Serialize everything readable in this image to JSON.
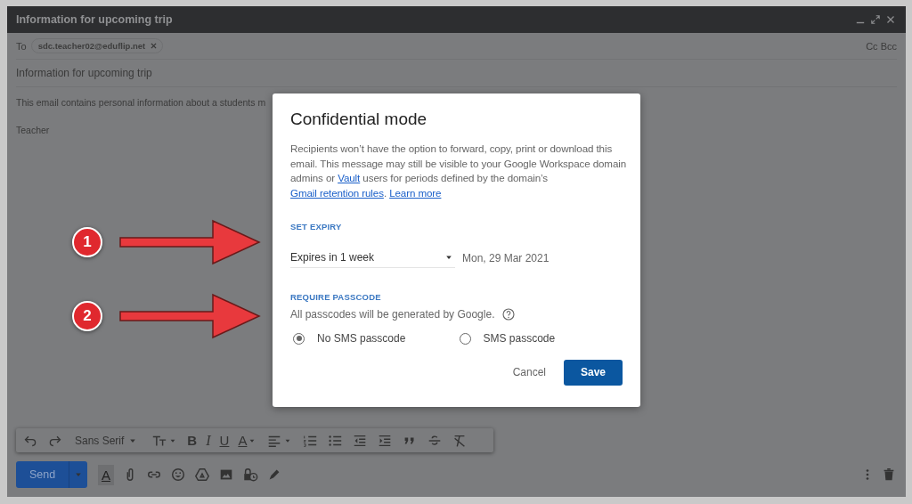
{
  "window": {
    "title": "Information for upcoming trip"
  },
  "compose": {
    "to_label": "To",
    "recipients": [
      {
        "address": "sdc.teacher02@eduflip.net"
      }
    ],
    "cc_bcc": "Cc Bcc",
    "subject": "Information for upcoming trip",
    "body_lines": [
      "This email contains personal information about a students m",
      "Teacher"
    ]
  },
  "format_toolbar": {
    "font": "Sans Serif",
    "glyphs": [
      "B",
      "I",
      "U",
      "A"
    ]
  },
  "bottom_bar": {
    "send": "Send",
    "formatting_glyph": "A"
  },
  "dialog": {
    "title": "Confidential mode",
    "description": [
      {
        "kind": "text",
        "text": "Recipients won’t have the option to forward, copy, print or download this email. This message may still be visible to your Google Workspace domain admins or "
      },
      {
        "kind": "link",
        "text": "Vault"
      },
      {
        "kind": "text",
        "text": " users for periods defined by the domain’s "
      },
      {
        "kind": "link",
        "text": "Gmail retention rules"
      },
      {
        "kind": "text",
        "text": ". "
      },
      {
        "kind": "link",
        "text": "Learn more"
      }
    ],
    "expiry_heading": "SET EXPIRY",
    "expiry_select": "Expires in 1 week",
    "expiry_date": "Mon, 29 Mar 2021",
    "passcode_heading": "REQUIRE PASSCODE",
    "passcode_note": "All passcodes will be generated by Google.",
    "options": [
      {
        "label": "No SMS passcode",
        "selected": true
      },
      {
        "label": "SMS passcode",
        "selected": false
      }
    ],
    "buttons": [
      {
        "kind": "text",
        "label": "Cancel"
      },
      {
        "kind": "primary",
        "label": "Save"
      }
    ]
  },
  "annotations": [
    {
      "number": "1"
    },
    {
      "number": "2"
    }
  ]
}
